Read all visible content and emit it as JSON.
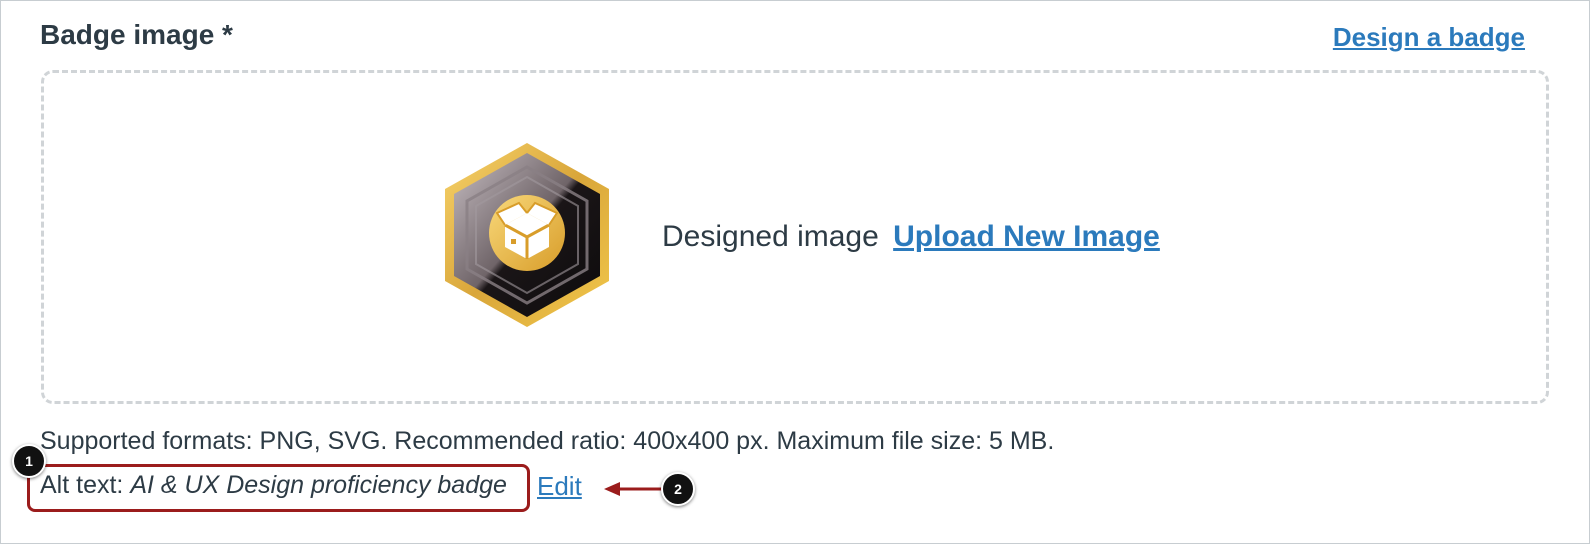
{
  "section": {
    "title": "Badge image *",
    "design_link": "Design a badge"
  },
  "dropzone": {
    "badge_icon": "open-box-hexagon-badge",
    "designed_label": "Designed image",
    "upload_link": "Upload New Image"
  },
  "formats_note": "Supported formats: PNG, SVG. Recommended ratio: 400x400 px. Maximum file size: 5 MB.",
  "alt_text": {
    "label": "Alt text:",
    "value": "AI & UX Design proficiency badge",
    "edit_link": "Edit"
  },
  "callouts": {
    "one": "1",
    "two": "2"
  },
  "colors": {
    "link": "#2b7abc",
    "text": "#2d3b45",
    "highlight": "#9b1c1c",
    "badge_gold": "#e8b93a"
  }
}
